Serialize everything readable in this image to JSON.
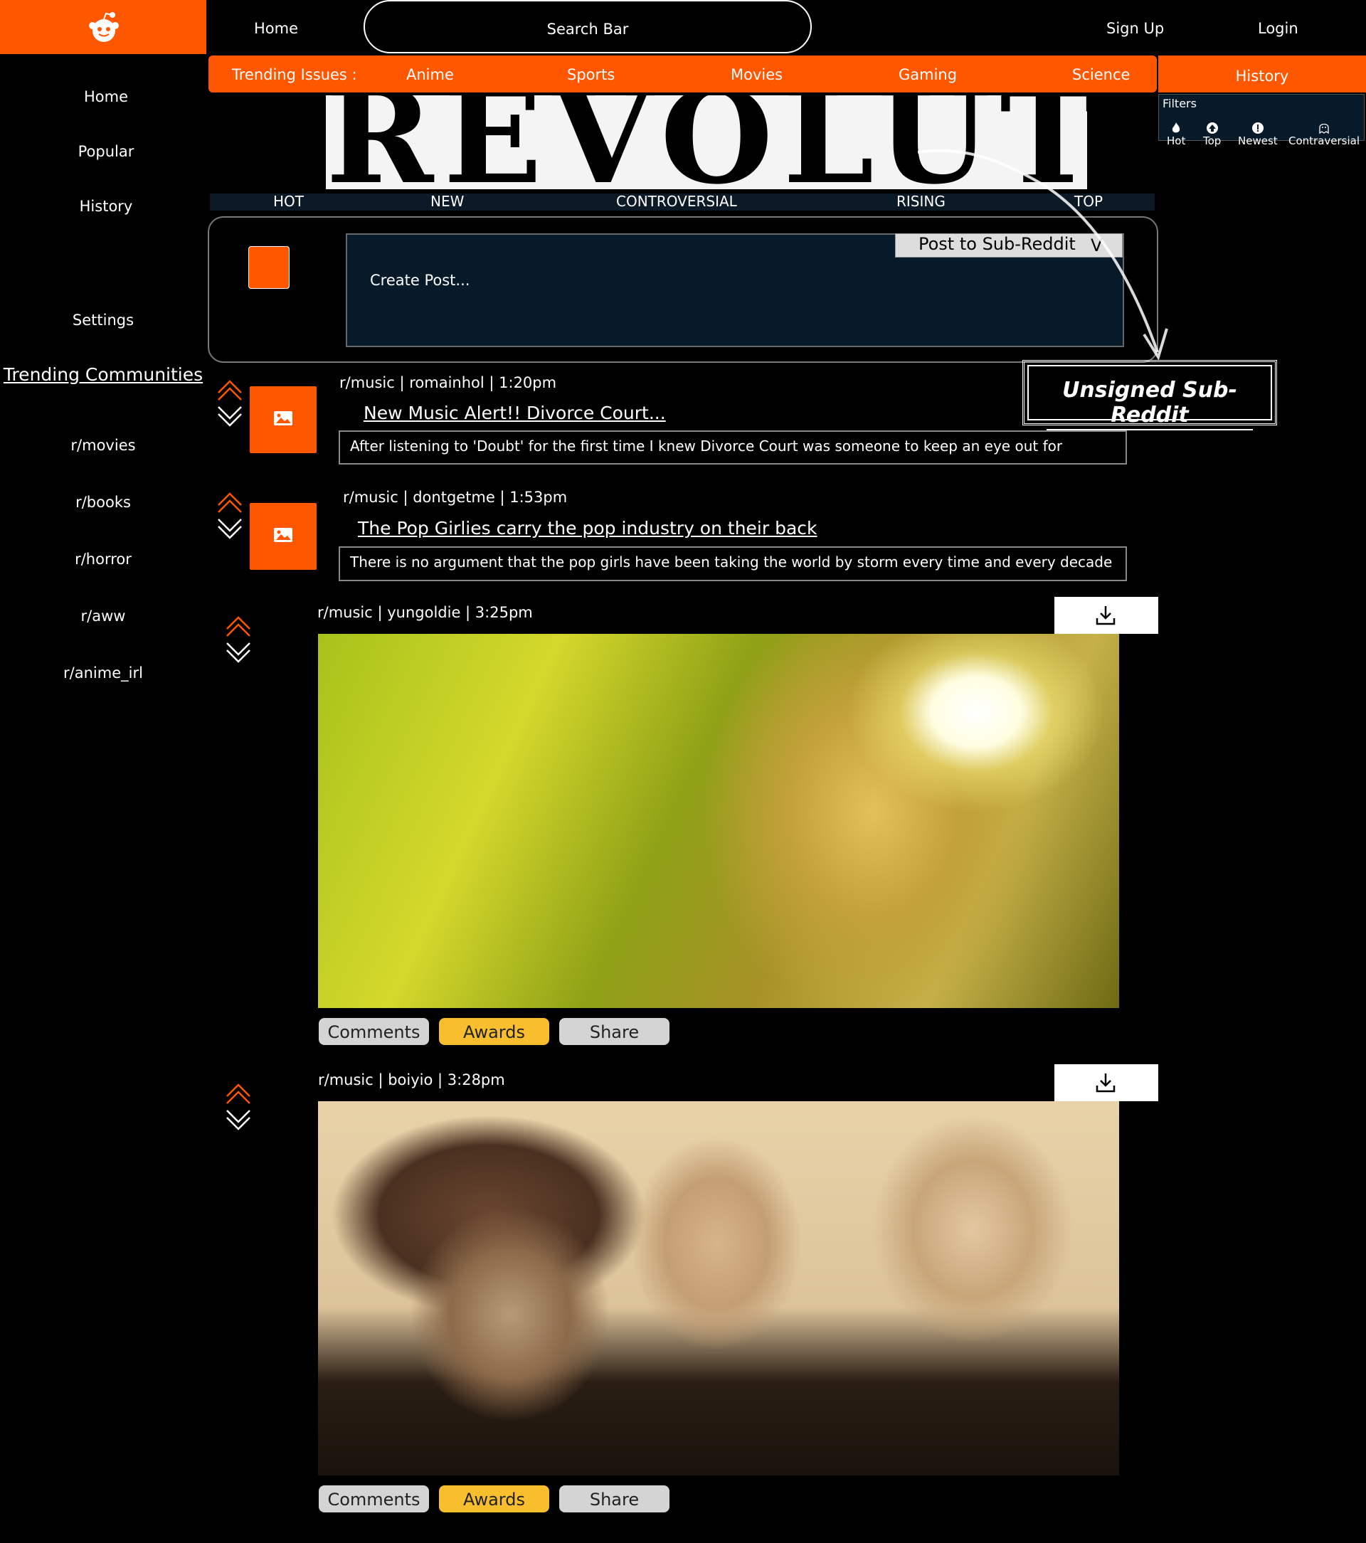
{
  "header": {
    "home": "Home",
    "search_placeholder": "Search Bar",
    "sign_up": "Sign Up",
    "login": "Login"
  },
  "sidebar": {
    "items": [
      "Home",
      "Popular",
      "History",
      "Settings"
    ],
    "trending_title": "Trending Communities",
    "communities": [
      "r/movies",
      "r/books",
      "r/horror",
      "r/aww",
      "r/anime_irl"
    ]
  },
  "trending": {
    "label": "Trending Issues :",
    "items": [
      "Anime",
      "Sports",
      "Movies",
      "Gaming",
      "Science"
    ]
  },
  "history_tab": "History",
  "filters": {
    "title": "Filters",
    "items": [
      "Hot",
      "Top",
      "Newest",
      "Contraversial"
    ]
  },
  "banner": {
    "text": "REVOLUTION"
  },
  "sort_tabs": [
    "HOT",
    "NEW",
    "CONTROVERSIAL",
    "RISING",
    "TOP"
  ],
  "create_post": {
    "placeholder": "Create Post...",
    "dropdown_label": "Post to Sub-Reddit",
    "dropdown_chevron": "V"
  },
  "callout": "Unsigned Sub-Reddit",
  "posts": [
    {
      "meta": "r/music | romainhol  | 1:20pm",
      "title": "New Music Alert!! Divorce Court...",
      "body": "After listening to 'Doubt' for the first time I knew Divorce Court was someone to keep an eye out for"
    },
    {
      "meta": "r/music | dontgetme  | 1:53pm",
      "title": "The Pop Girlies carry the pop industry on their back",
      "body": "There is no argument that the pop girls have been taking the world by storm every time and every decade"
    },
    {
      "meta": "r/music | yungoldie  | 3:25pm",
      "actions": [
        "Comments",
        "Awards",
        "Share"
      ]
    },
    {
      "meta": "r/music | boiyio  | 3:28pm",
      "actions": [
        "Comments",
        "Awards",
        "Share"
      ]
    }
  ],
  "colors": {
    "accent": "#ff5700",
    "awards": "#f8be2e",
    "panel": "#061a2a"
  }
}
